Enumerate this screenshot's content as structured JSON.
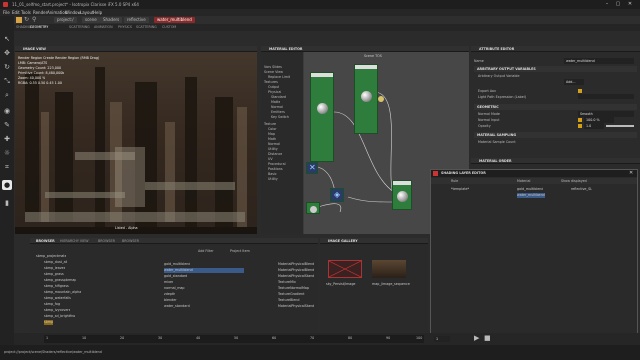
{
  "window": {
    "title": "11_01_selfmo_start.project* - Isotropix Clarisse iFX 5.0 SP4 x64",
    "controls": [
      "minimize",
      "maximize",
      "close"
    ]
  },
  "menubar": [
    "File",
    "Edit",
    "Tools",
    "Render",
    "Animation",
    "Window",
    "Layout",
    "Help"
  ],
  "breadcrumb": [
    "project:/",
    "scene",
    "Shaders",
    "reflective",
    "water_multiblend"
  ],
  "layout_tabs": [
    "SHADING",
    "GEOMETRY",
    "SCATTERING",
    "ANIMATION",
    "PHYSICS",
    "SCATTERING",
    "CUSTOM"
  ],
  "toolbar_icons": [
    "select-icon",
    "move-icon",
    "rotate-icon",
    "scale-icon",
    "zoom-icon",
    "camera-icon",
    "paint-icon",
    "pick-icon",
    "light-icon",
    "crop-icon",
    "render-icon",
    "snapshot-icon"
  ],
  "image_view": {
    "title": "IMAGE VIEW",
    "overlay": [
      "Render Region Create Render Region (RMB Drag)",
      "LMB: Camera/ATS",
      "Geometry Count: 223,000",
      "Primitive Count: 8,480,000b",
      "Zoom: 40,000 %",
      "RGBA: 0.55 0.50 0.45 1.00"
    ],
    "status": "Listed - Alpha"
  },
  "material_editor": {
    "title": "MATERIAL EDITOR",
    "tree": [
      "Vars Slides",
      "Scene View",
      "Replace Limit",
      "Textures",
      "Output",
      "Physical",
      "Standard",
      "Matte",
      "Normal",
      "Emitters",
      "Key Switch",
      "Texture",
      "Color",
      "Map",
      "Math",
      "Normal",
      "Utility",
      "Distance",
      "UV",
      "Procedural",
      "Positions",
      "Basic",
      "Utility"
    ],
    "graph_label": "Scene TOS",
    "nodes": [
      "gold_standard",
      "water_standard",
      "normal",
      "mixer",
      "zdepth",
      "water_multiblend"
    ]
  },
  "attribute_editor": {
    "title": "ATTRIBUTE EDITOR",
    "name_label": "Name",
    "name_value": "water_multiblend",
    "sec_arbitrary": "ARBITRARY OUTPUT VARIABLES",
    "aov_label": "Arbitrary Output Variable",
    "aov_btn": "Add...",
    "export_label": "Export Aov",
    "light_path_label": "Light Path Expression (Label)",
    "sec_geometric": "GEOMETRIC",
    "normal_mode_label": "Normal Mode",
    "normal_mode_value": "Smooth",
    "normal_input_label": "Normal Input",
    "normal_input_value": "100.0 %",
    "opacity_label": "Opacity",
    "opacity_value": "1.0",
    "sec_sampling": "MATERIAL SAMPLING",
    "sample_count_label": "Material Sample Count"
  },
  "material_order": {
    "title": "MATERIAL ORDER"
  },
  "shading_layer_editor": {
    "title": "SHADING LAYER EDITOR",
    "col_rule": "Rule",
    "col_material": "Material",
    "col_shown": "Show displayed",
    "rule": "*template*",
    "materials": [
      "gold_multiblend",
      "water_multibend"
    ],
    "assigned": "reflective_SL"
  },
  "browser": {
    "tabs": [
      "BROWSER",
      "HIERARCHY VIEW",
      "BROWSER",
      "BROWSER"
    ],
    "folders": [
      "sbmp_projectmats",
      "sbmp_dust_all",
      "sbmp_leaves",
      "sbmp_grass",
      "sbmp_grasspbrmap",
      "sbmp_hifigrass",
      "sbmp_mountain_alpha",
      "sbmp_waterfalls",
      "sbmp_fog",
      "sbmp_ivycovers",
      "sbmp_sd_brightfno",
      "sbmp"
    ],
    "files": [
      "gold_multiblend",
      "water_multiblend",
      "gold_standard",
      "mixer",
      "normal_map",
      "zdepth",
      "blender",
      "water_standard"
    ],
    "types": [
      "MaterialPhysicalBlend",
      "MaterialPhysicalBlend",
      "MaterialPhysicalStandard",
      "TextureMix",
      "TextureNormalMap",
      "TextureGradient",
      "TextureBlend",
      "MaterialPhysicalStandard"
    ],
    "add_label": "Add Filter",
    "path_label": "Project Item"
  },
  "image_gallery": {
    "title": "IMAGE GALLERY",
    "items": [
      "sky_Persist/Image",
      "map_/image_sequence"
    ]
  },
  "timeline": {
    "ticks": [
      "1",
      "10",
      "20",
      "30",
      "40",
      "50",
      "60",
      "70",
      "80",
      "90",
      "100"
    ],
    "frame": "1"
  },
  "status": {
    "path": "project://project/scene/Shaders/reflective/water_multiblend"
  },
  "colors": {
    "node_green": "#2f7d3c",
    "accent_red": "#8a2a2a",
    "attribute_yellow": "#d4a017"
  }
}
